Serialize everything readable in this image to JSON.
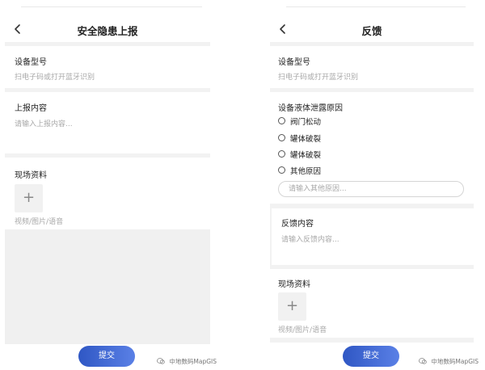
{
  "left": {
    "title": "安全隐患上报",
    "device_label": "设备型号",
    "device_hint": "扫电子码或打开蓝牙识别",
    "report_label": "上报内容",
    "report_placeholder": "请输入上报内容...",
    "media_label": "现场资料",
    "media_plus": "+",
    "media_hint": "视频/图片/语音",
    "submit_label": "提交",
    "watermark": "中地数码MapGIS"
  },
  "right": {
    "title": "反馈",
    "device_label": "设备型号",
    "device_hint": "扫电子码或打开蓝牙识别",
    "cause_label": "设备液体泄露原因",
    "options": [
      "阀门松动",
      "罐体破裂",
      "罐体破裂",
      "其他原因"
    ],
    "other_placeholder": "请输入其他原因...",
    "feedback_label": "反馈内容",
    "feedback_placeholder": "请输入反馈内容...",
    "media_label": "现场资料",
    "media_plus": "+",
    "media_hint": "视频/图片/语音",
    "submit_label": "提交",
    "watermark": "中地数码MapGIS"
  },
  "colors": {
    "accent": "#3a62d0",
    "divider": "#f2f2f2",
    "hint": "#a8a8a8"
  }
}
